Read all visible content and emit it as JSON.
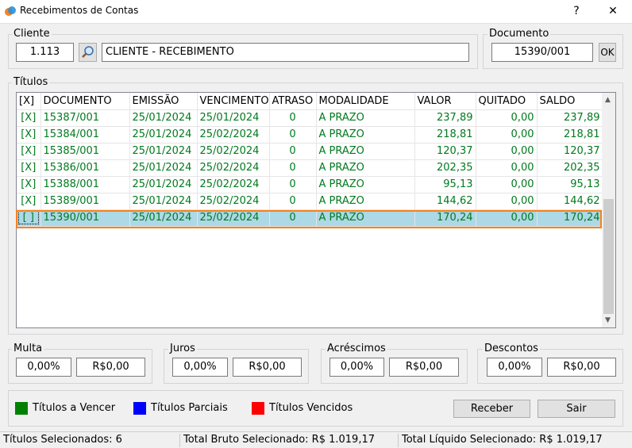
{
  "window": {
    "title": "Recebimentos de Contas",
    "help": "?",
    "close": "✕"
  },
  "cliente": {
    "label": "Cliente",
    "code": "1.113",
    "name": "CLIENTE - RECEBIMENTO"
  },
  "documento": {
    "label": "Documento",
    "value": "15390/001",
    "ok": "OK"
  },
  "titulos": {
    "label": "Títulos",
    "headers": [
      "[X]",
      "DOCUMENTO",
      "EMISSÃO",
      "VENCIMENTO",
      "ATRASO",
      "MODALIDADE",
      "VALOR",
      "QUITADO",
      "SALDO"
    ],
    "rows": [
      [
        "[X]",
        "15387/001",
        "25/01/2024",
        "25/01/2024",
        "0",
        "A PRAZO",
        "237,89",
        "0,00",
        "237,89"
      ],
      [
        "[X]",
        "15384/001",
        "25/01/2024",
        "25/02/2024",
        "0",
        "A PRAZO",
        "218,81",
        "0,00",
        "218,81"
      ],
      [
        "[X]",
        "15385/001",
        "25/01/2024",
        "25/02/2024",
        "0",
        "A PRAZO",
        "120,37",
        "0,00",
        "120,37"
      ],
      [
        "[X]",
        "15386/001",
        "25/01/2024",
        "25/02/2024",
        "0",
        "A PRAZO",
        "202,35",
        "0,00",
        "202,35"
      ],
      [
        "[X]",
        "15388/001",
        "25/01/2024",
        "25/02/2024",
        "0",
        "A PRAZO",
        "95,13",
        "0,00",
        "95,13"
      ],
      [
        "[X]",
        "15389/001",
        "25/01/2024",
        "25/02/2024",
        "0",
        "A PRAZO",
        "144,62",
        "0,00",
        "144,62"
      ],
      [
        "[ ]",
        "15390/001",
        "25/01/2024",
        "25/02/2024",
        "0",
        "A PRAZO",
        "170,24",
        "0,00",
        "170,24"
      ]
    ],
    "selected_row": 6
  },
  "multa": {
    "label": "Multa",
    "percent": "0,00%",
    "value": "R$0,00"
  },
  "juros": {
    "label": "Juros",
    "percent": "0,00%",
    "value": "R$0,00"
  },
  "acrescimos": {
    "label": "Acréscimos",
    "percent": "0,00%",
    "value": "R$0,00"
  },
  "descontos": {
    "label": "Descontos",
    "percent": "0,00%",
    "value": "R$0,00"
  },
  "legend": {
    "vencer": {
      "label": "Títulos a Vencer",
      "color": "#008000"
    },
    "parciais": {
      "label": "Títulos Parciais",
      "color": "#0000ff"
    },
    "vencidos": {
      "label": "Títulos Vencidos",
      "color": "#ff0000"
    }
  },
  "buttons": {
    "receber": "Receber",
    "sair": "Sair"
  },
  "status": {
    "selecionados": "Títulos Selecionados: 6",
    "bruto": "Total Bruto Selecionado: R$ 1.019,17",
    "liquido": "Total Líquido Selecionado: R$ 1.019,17"
  }
}
